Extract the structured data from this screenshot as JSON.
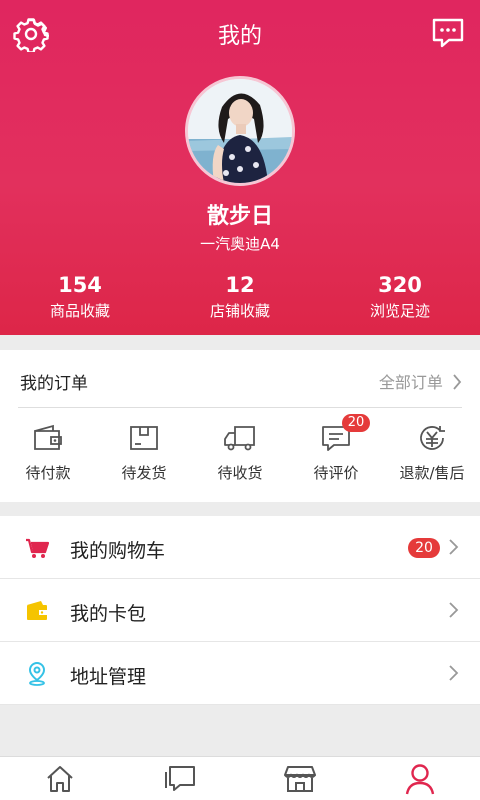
{
  "header": {
    "title": "我的",
    "settings_icon": "gear-icon",
    "message_icon": "chat-bubble-icon",
    "nickname": "散步日",
    "car_model": "一汽奥迪A4"
  },
  "stats": [
    {
      "value": "154",
      "label": "商品收藏"
    },
    {
      "value": "12",
      "label": "店铺收藏"
    },
    {
      "value": "320",
      "label": "浏览足迹"
    }
  ],
  "orders": {
    "title": "我的订单",
    "all_link": "全部订单",
    "tabs": [
      {
        "label": "待付款",
        "icon": "wallet-icon"
      },
      {
        "label": "待发货",
        "icon": "box-icon"
      },
      {
        "label": "待收货",
        "icon": "truck-icon"
      },
      {
        "label": "待评价",
        "icon": "comment-icon",
        "badge": "20"
      },
      {
        "label": "退款/售后",
        "icon": "refund-yen-icon"
      }
    ]
  },
  "menu": [
    {
      "label": "我的购物车",
      "icon": "cart-icon",
      "badge": "20"
    },
    {
      "label": "我的卡包",
      "icon": "card-wallet-icon"
    },
    {
      "label": "地址管理",
      "icon": "location-pin-icon"
    }
  ],
  "tabbar": [
    {
      "icon": "home-icon",
      "active": false
    },
    {
      "icon": "messages-icon",
      "active": false
    },
    {
      "icon": "store-icon",
      "active": false
    },
    {
      "icon": "user-icon",
      "active": true
    }
  ],
  "colors": {
    "header_bg": "#e0265f",
    "badge": "#e53a3a",
    "active_tab": "#e0264e",
    "cart_icon": "#e0264e",
    "card_icon": "#f5c400",
    "location_icon": "#35c2e6"
  }
}
